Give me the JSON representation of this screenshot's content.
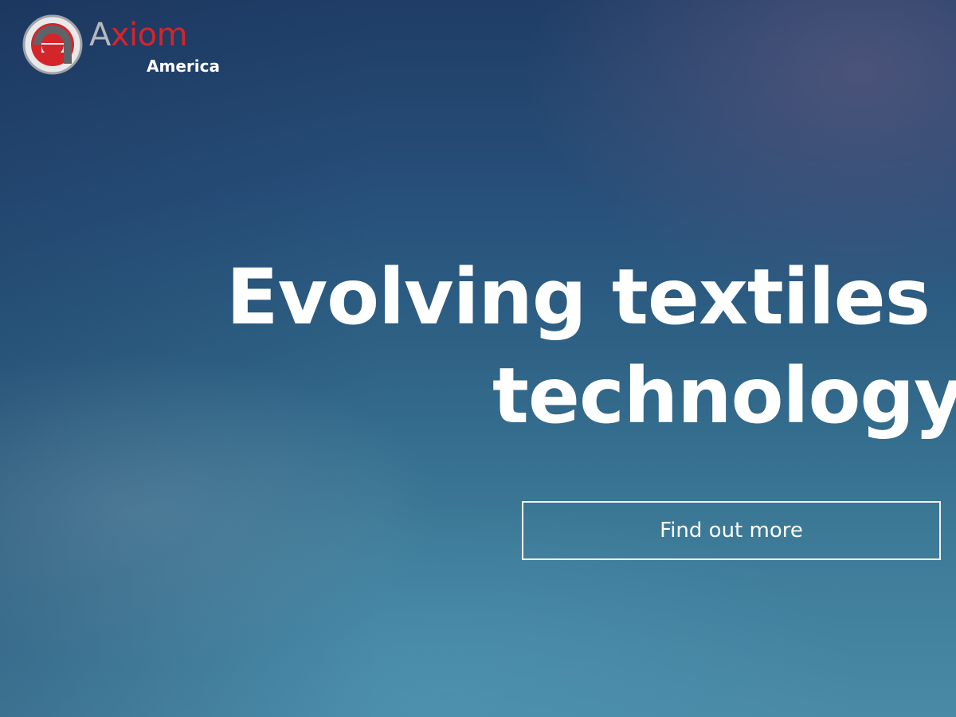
{
  "brand": {
    "name": "Axiom",
    "sub": "America",
    "colors": {
      "red": "#d4252b",
      "gray": "#b5b8bd",
      "white": "#ffffff"
    },
    "icon": "axiom-a-logo-icon"
  },
  "hero": {
    "headline_line1": "Evolving textiles th",
    "headline_line2": "technology.",
    "cta_label": "Find out more",
    "background_colors": [
      "#1f3d66",
      "#2f6386",
      "#4a8aa6"
    ]
  }
}
